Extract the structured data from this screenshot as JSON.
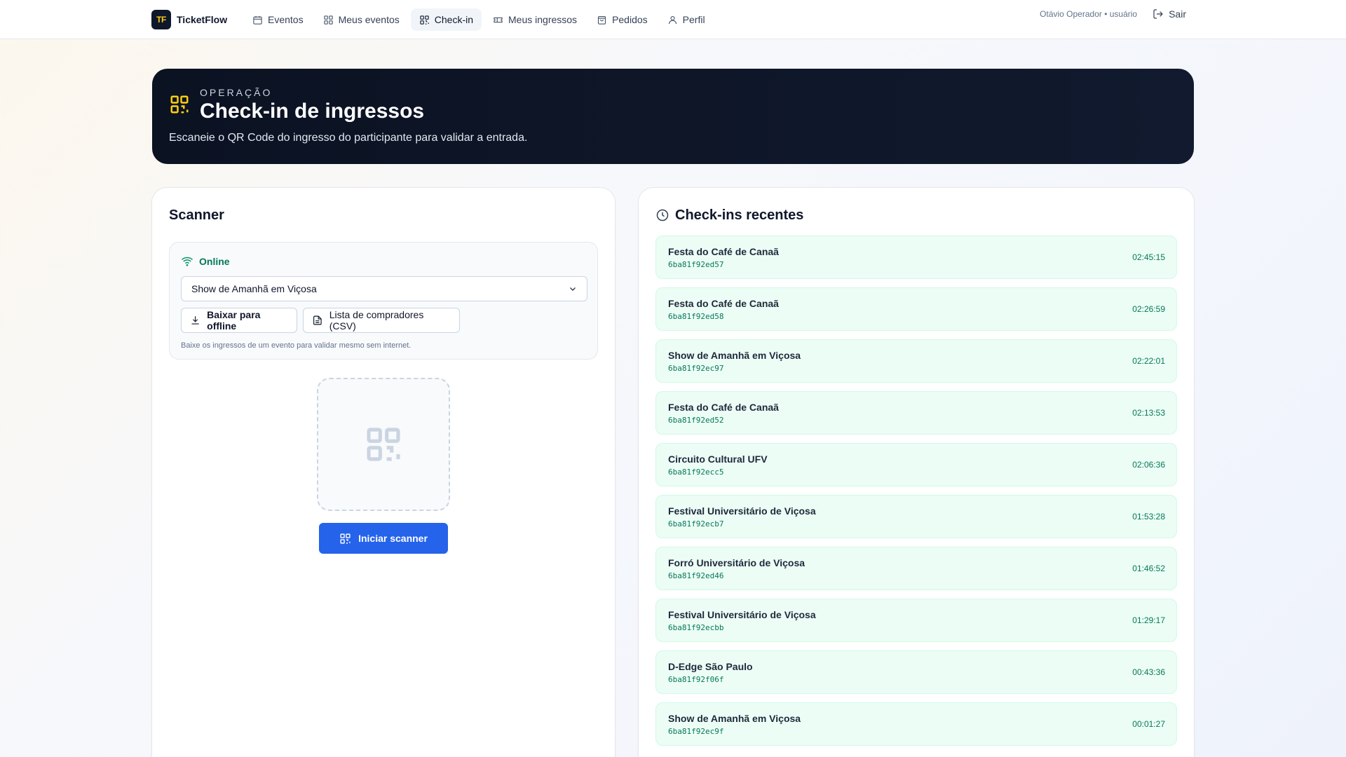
{
  "brand": {
    "logo": "TF",
    "name": "TicketFlow"
  },
  "nav": {
    "items": [
      {
        "label": "Eventos",
        "icon": "calendar-icon",
        "active": false
      },
      {
        "label": "Meus eventos",
        "icon": "grid-icon",
        "active": false
      },
      {
        "label": "Check-in",
        "icon": "qr-icon",
        "active": true
      },
      {
        "label": "Meus ingressos",
        "icon": "ticket-icon",
        "active": false
      },
      {
        "label": "Pedidos",
        "icon": "bag-icon",
        "active": false
      },
      {
        "label": "Perfil",
        "icon": "user-icon",
        "active": false
      }
    ],
    "user": "Otávio Operador • usuário",
    "logout": "Sair"
  },
  "hero": {
    "eyebrow": "OPERAÇÃO",
    "title": "Check-in de ingressos",
    "subtitle": "Escaneie o QR Code do ingresso do participante para validar a entrada."
  },
  "scanner": {
    "title": "Scanner",
    "status": "Online",
    "selected_event": "Show de Amanhã em Viçosa",
    "download_button": "Baixar para offline",
    "csv_button": "Lista de compradores (CSV)",
    "hint": "Baixe os ingressos de um evento para validar mesmo sem internet.",
    "start_button": "Iniciar scanner"
  },
  "recent": {
    "title": "Check-ins recentes",
    "items": [
      {
        "event": "Festa do Café de Canaã",
        "code": "6ba81f92ed57",
        "time": "02:45:15"
      },
      {
        "event": "Festa do Café de Canaã",
        "code": "6ba81f92ed58",
        "time": "02:26:59"
      },
      {
        "event": "Show de Amanhã em Viçosa",
        "code": "6ba81f92ec97",
        "time": "02:22:01"
      },
      {
        "event": "Festa do Café de Canaã",
        "code": "6ba81f92ed52",
        "time": "02:13:53"
      },
      {
        "event": "Circuito Cultural UFV",
        "code": "6ba81f92ecc5",
        "time": "02:06:36"
      },
      {
        "event": "Festival Universitário de Viçosa",
        "code": "6ba81f92ecb7",
        "time": "01:53:28"
      },
      {
        "event": "Forró Universitário de Viçosa",
        "code": "6ba81f92ed46",
        "time": "01:46:52"
      },
      {
        "event": "Festival Universitário de Viçosa",
        "code": "6ba81f92ecbb",
        "time": "01:29:17"
      },
      {
        "event": "D-Edge São Paulo",
        "code": "6ba81f92f06f",
        "time": "00:43:36"
      },
      {
        "event": "Show de Amanhã em Viçosa",
        "code": "6ba81f92ec9f",
        "time": "00:01:27"
      }
    ]
  },
  "colors": {
    "accent": "#2563eb",
    "success": "#047857",
    "hero_bg": "#0b1222",
    "brand_yellow": "#facc15"
  }
}
